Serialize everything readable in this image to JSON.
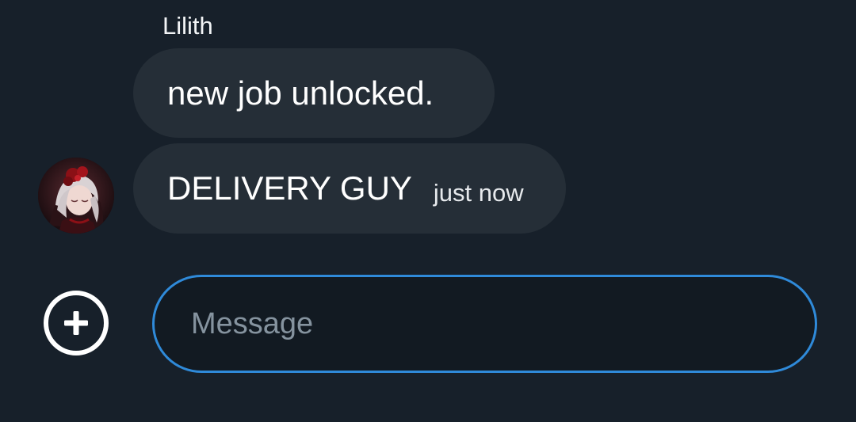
{
  "thread": {
    "sender_name": "Lilith",
    "messages": [
      {
        "text": "new job unlocked.",
        "timestamp": ""
      },
      {
        "text": "DELIVERY GUY",
        "timestamp": "just now"
      }
    ]
  },
  "composer": {
    "placeholder": "Message",
    "add_icon": "plus-circle-icon"
  },
  "colors": {
    "background": "#17202a",
    "bubble": "#252e37",
    "input_border": "#2f8ad9",
    "input_background": "#121a22",
    "placeholder": "#85939f"
  }
}
